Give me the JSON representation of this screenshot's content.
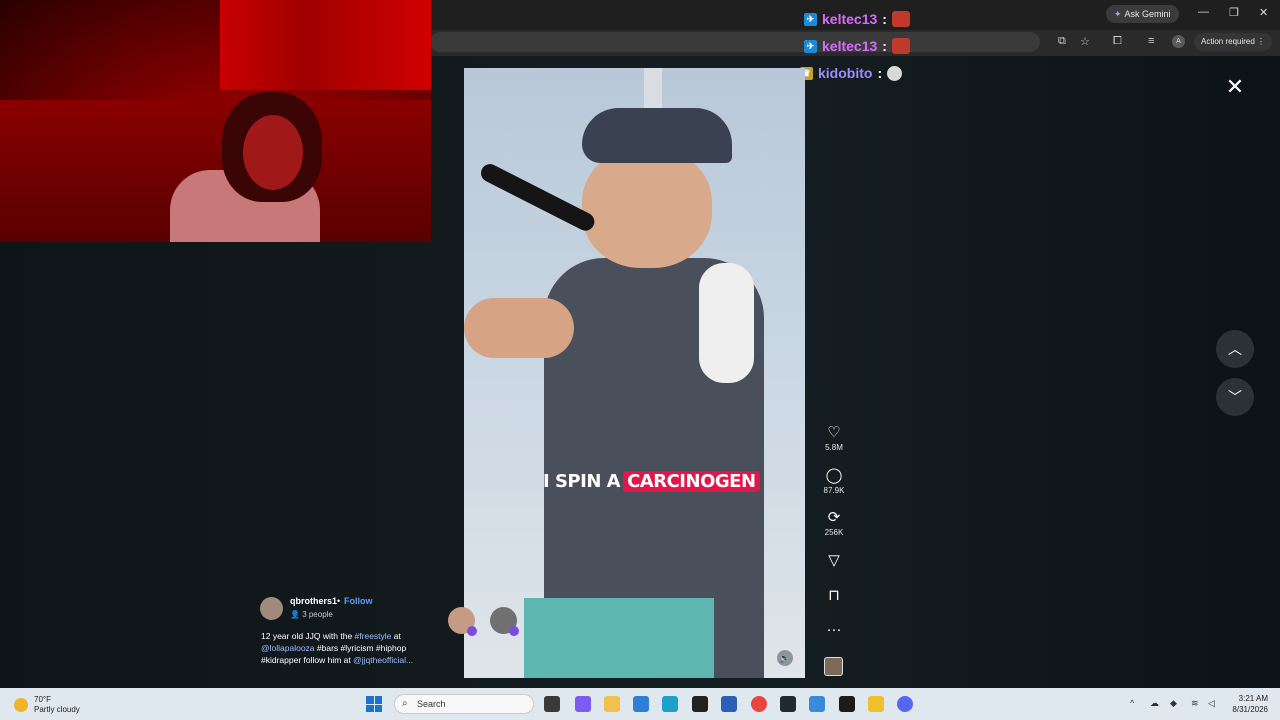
{
  "browser": {
    "ask_gemini": "Ask Gemini",
    "action_required": "Action required",
    "avatar_letter": "A"
  },
  "chat": [
    {
      "user": "keltec13",
      "sep": ":",
      "badge": "prime-icon"
    },
    {
      "user": "keltec13",
      "sep": ":",
      "badge": "prime-icon"
    },
    {
      "user": "kidobito",
      "sep": ":",
      "badge": "sub-icon"
    }
  ],
  "video": {
    "caption_plain": "I SPIN A",
    "caption_highlight": "CARCINOGEN"
  },
  "rail": {
    "likes": "5.8M",
    "comments": "87.9K",
    "reposts": "256K"
  },
  "post": {
    "username": "qbrothers1",
    "dot": "•",
    "follow": "Follow",
    "people": "3 people",
    "desc_1": "12 year old JJQ with the ",
    "tag_freestyle": "#freestyle",
    "desc_2": " at ",
    "tag_lolla": "@lollapalooza",
    "tags_mid": " #bars #lyricism #hiphop #kidrapper ",
    "desc_3": "follow him at ",
    "tag_jjq": "@jjqtheofficial..."
  },
  "taskbar": {
    "temp": "70°F",
    "weather": "Partly cloudy",
    "search_placeholder": "Search",
    "time": "3:21 AM",
    "date": "8/31/2026"
  }
}
